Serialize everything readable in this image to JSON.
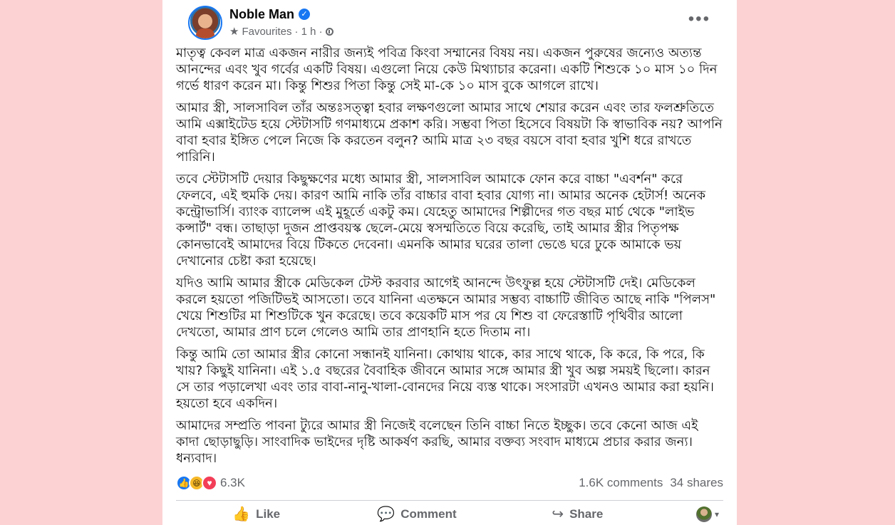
{
  "post": {
    "author": "Noble Man",
    "audience": "Favourites",
    "time": "· 1 h ·",
    "more_label": "•••",
    "paragraphs": [
      "মাতৃত্ব কেবল মাত্র একজন নারীর জন্যই পবিত্র কিংবা সম্মানের বিষয় নয়। একজন পুরুষের জন্যেও অত্যন্ত আনন্দের এবং খুব গর্বের একটি বিষয়। এগুলো নিয়ে কেউ মিথ্যাচার করেনা। একটি শিশুকে ১০ মাস ১০ দিন গর্ভে ধারণ করেন মা। কিন্তু শিশুর পিতা কিন্তু সেই মা-কে ১০ মাস বুকে আগলে রাখে।",
      "আমার স্ত্রী, সালসাবিল তাঁর অন্তঃসত্ত্বা হবার লক্ষণগুলো আমার সাথে শেয়ার করেন এবং তার ফলশ্রুতিতে আমি এক্সাইটেড হয়ে স্টেটাসটি গণমাধ্যমে প্রকাশ করি। সম্ভবা পিতা হিসেবে বিষয়টা কি স্বাভাবিক নয়? আপনি বাবা হবার ইঙ্গিত পেলে নিজে কি করতেন বলুন? আমি মাত্র ২৩ বছর বয়সে বাবা হবার খুশি ধরে রাখতে পারিনি।",
      "তবে স্টেটাসটি দেয়ার কিছুক্ষণের মধ্যে আমার স্ত্রী, সালসাবিল আমাকে ফোন করে বাচ্চা \"এবর্শন\" করে ফেলবে, এই হুমকি দেয়। কারণ আমি নাকি তাঁর বাচ্চার বাবা হবার যোগ্য না। আমার অনেক হেটার্স! অনেক কন্ট্রোভার্সি। ব্যাংক ব্যালেন্স এই মুহূর্তে একটু কম। যেহেতু আমাদের শিল্পীদের গত বছর মার্চ থেকে \"লাইভ কন্সার্ট\" বন্ধ। তাছাড়া দুজন প্রাপ্তবয়স্ক ছেলে-মেয়ে স্বসম্মতিতে বিয়ে করেছি, তাই আমার স্ত্রীর পিতৃপক্ষ কোনভাবেই আমাদের বিয়ে টিকতে দেবেনা। এমনকি আমার ঘরের তালা ভেঙে ঘরে ঢুকে আমাকে ভয় দেখানোর চেষ্টা করা হয়েছে।",
      "যদিও আমি আমার স্ত্রীকে মেডিকেল টেস্ট করবার আগেই আনন্দে উৎফুল্ল হয়ে স্টেটাসটি দেই। মেডিকেল করলে হয়তো পজিটিভই আসতো। তবে যানিনা এতক্ষনে আমার সম্ভব্য বাচ্চাটি জীবিত আছে নাকি \"পিলস\" খেয়ে শিশুটির মা শিশুটিকে খুন করেছে। তবে কয়েকটি মাস পর যে শিশু বা ফেরেস্তাটি পৃথিবীর আলো দেখতো, আমার প্রাণ চলে গেলেও আমি তার প্রাণহানি হতে দিতাম না।",
      "কিন্তু আমি তো আমার স্ত্রীর কোনো সন্ধানই যানিনা। কোথায় থাকে, কার সাথে থাকে, কি করে, কি পরে, কি খায়? কিছুই যানিনা। এই ১.৫ বছরের বৈবাহিক জীবনে আমার সঙ্গে আমার স্ত্রী খুব অল্প সময়ই ছিলো। কারন সে তার পড়ালেখা এবং তার বাবা-নানু-খালা-বোনদের নিয়ে ব্যস্ত থাকে। সংসারটা এখনও আমার করা হয়নি। হয়তো হবে একদিন।",
      "আমাদের সম্প্রতি পাবনা ট্যুরে আমার স্ত্রী নিজেই বলেছেন তিনি বাচ্চা নিতে ইচ্ছুক। তবে কেনো আজ এই কাদা ছোড়াছুড়ি। সাংবাদিক ভাইদের দৃষ্টি আকর্ষণ করছি, আমার বক্তব্য সংবাদ মাধ্যমে প্রচার করার জন্য। ধন্যবাদ।"
    ],
    "reactions_count": "6.3K",
    "comments": "1.6K comments",
    "shares": "34 shares",
    "actions": {
      "like": "Like",
      "comment": "Comment",
      "share": "Share"
    }
  },
  "icons": {
    "verified": "verified-check-icon",
    "favourites": "star-icon",
    "public": "globe-icon",
    "like": "thumb-up-icon",
    "comment": "comment-bubble-icon",
    "share": "share-arrow-icon"
  },
  "colors": {
    "background": "#fcd2d3",
    "card": "#ffffff",
    "facebook_blue": "#1877f2",
    "secondary_text": "#65676b"
  }
}
